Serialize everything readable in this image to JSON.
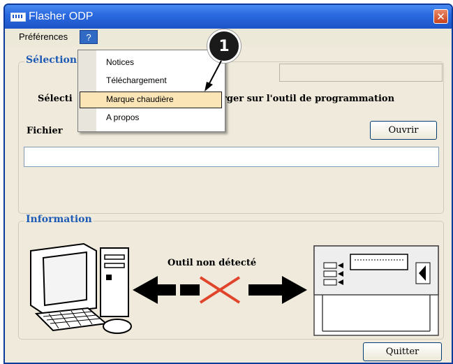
{
  "window": {
    "title": "Flasher ODP",
    "close_glyph": "✕"
  },
  "menubar": {
    "preferences": "Préférences",
    "help": "?"
  },
  "dropdown": {
    "items": [
      "Notices",
      "Téléchargement",
      "Marque chaudière",
      "A propos"
    ],
    "highlighted": "Marque chaudière"
  },
  "callout": {
    "number": "1"
  },
  "selection": {
    "legend": "Sélection",
    "instruction_left": "Sélecti",
    "instruction_right": "rger sur l'outil de programmation"
  },
  "file": {
    "label": "Fichier",
    "open_button": "Ouvrir",
    "value": ""
  },
  "information": {
    "legend": "Information",
    "status": "Outil non détecté"
  },
  "footer": {
    "quit_button": "Quitter"
  },
  "colors": {
    "title_bar": "#2a6ae0",
    "legend_blue": "#1d5ab5",
    "menu_highlight": "#fbe5b6",
    "error_cross": "#e0442a"
  }
}
